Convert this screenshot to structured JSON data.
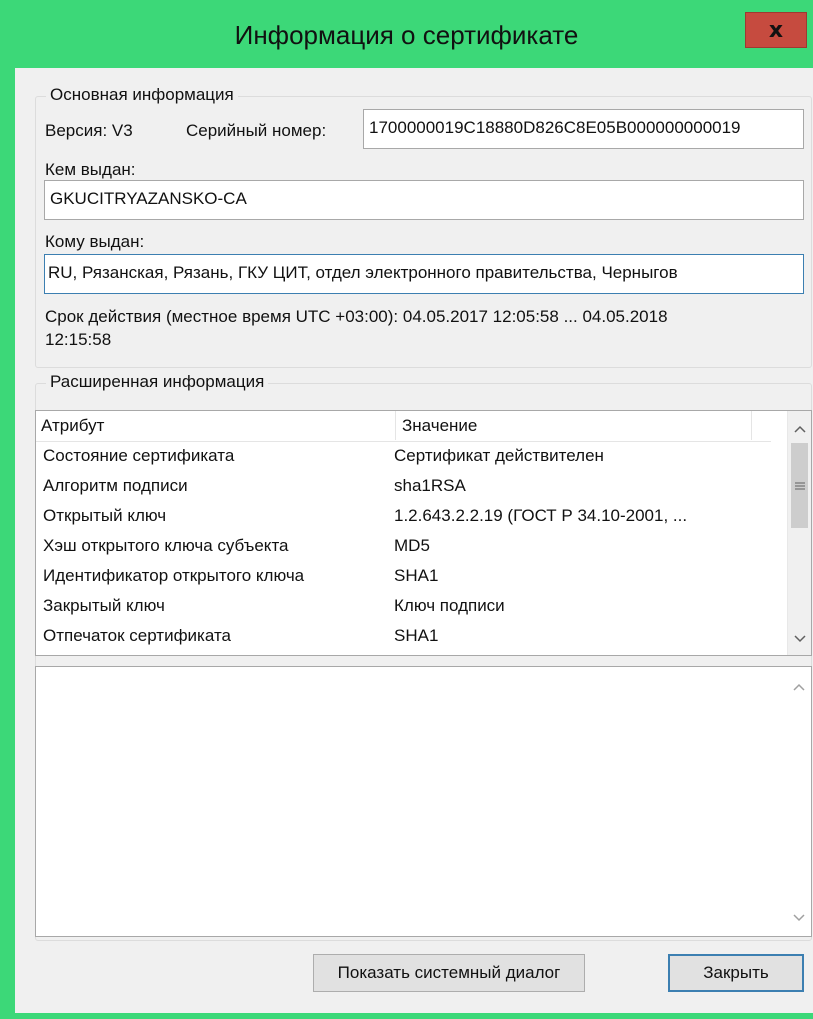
{
  "window": {
    "title": "Информация о сертификате",
    "close_glyph": "x"
  },
  "basic_info": {
    "group_title": "Основная информация",
    "version_label": "Версия: V3",
    "serial_label": "Серийный номер:",
    "serial_value": "1700000019C18880D826C8E05B000000000019",
    "issued_by_label": "Кем выдан:",
    "issued_by_value": "GKUCITRYAZANSKO-CA",
    "issued_to_label": "Кому выдан:",
    "issued_to_value": "RU, Рязанская, Рязань, ГКУ ЦИТ, отдел электронного правительства, Черныгов",
    "validity_line1": "Срок действия (местное время UTC +03:00):  04.05.2017 12:05:58 ... 04.05.2018",
    "validity_line2": "12:15:58"
  },
  "extended_info": {
    "group_title": "Расширенная информация",
    "columns": [
      "Атрибут",
      "Значение"
    ],
    "rows": [
      {
        "attr": "Состояние сертификата",
        "value": "Сертификат действителен"
      },
      {
        "attr": "Алгоритм подписи",
        "value": "sha1RSA"
      },
      {
        "attr": "Открытый ключ",
        "value": "1.2.643.2.2.19 (ГОСТ Р 34.10-2001, ..."
      },
      {
        "attr": "Хэш открытого ключа субъекта",
        "value": "MD5"
      },
      {
        "attr": "Идентификатор открытого ключа",
        "value": "SHA1"
      },
      {
        "attr": "Закрытый ключ",
        "value": "Ключ подписи"
      },
      {
        "attr": "Отпечаток сертификата",
        "value": "SHA1"
      }
    ],
    "details_text": ""
  },
  "buttons": {
    "system_dialog": "Показать системный диалог",
    "close": "Закрыть"
  },
  "colors": {
    "titlebar": "#3cd878",
    "close_button": "#c64b3f",
    "focus_border": "#3c7fb1"
  }
}
